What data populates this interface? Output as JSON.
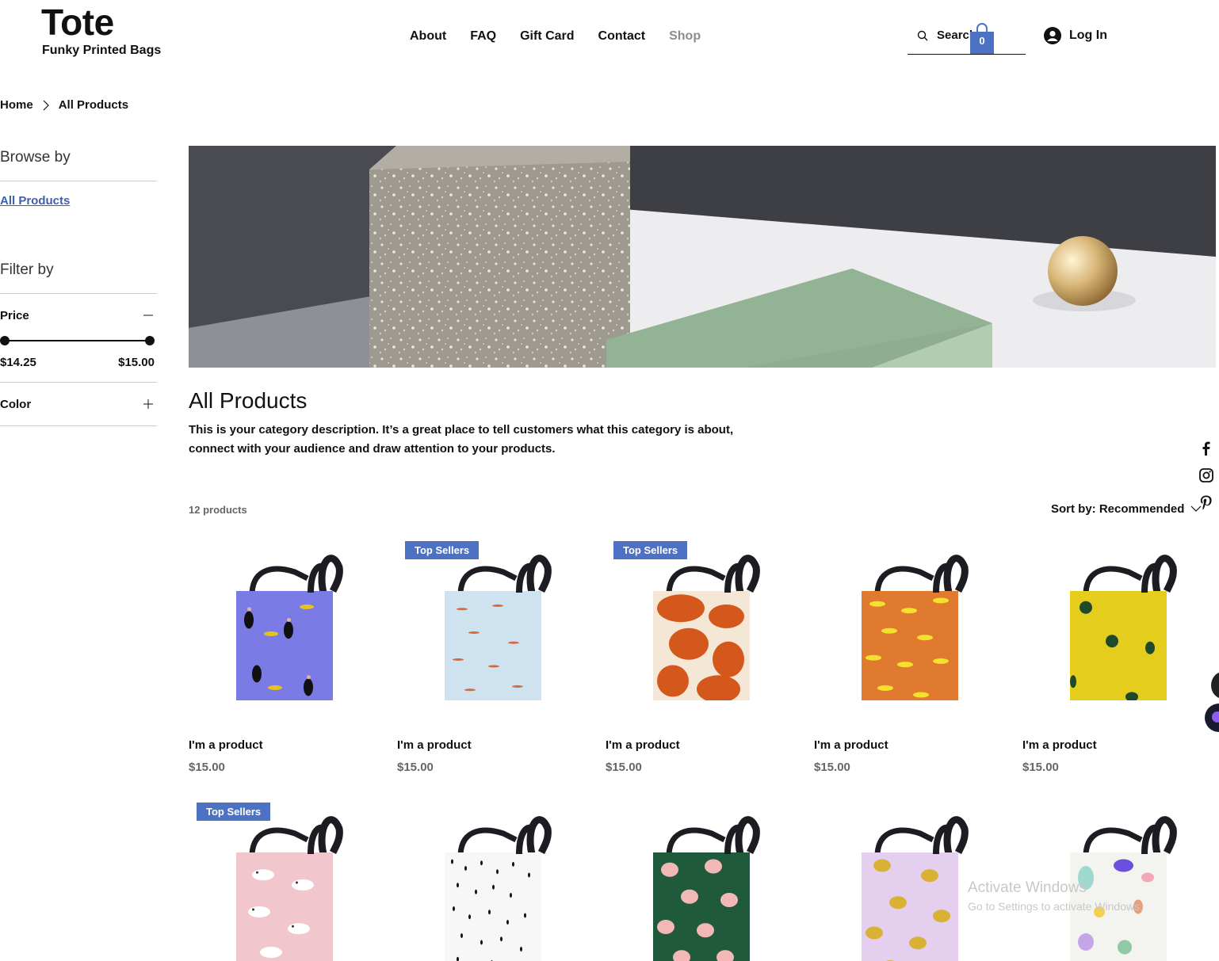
{
  "header": {
    "logo_title": "Tote",
    "logo_subtitle": "Funky Printed Bags",
    "nav": [
      "About",
      "FAQ",
      "Gift Card",
      "Contact",
      "Shop"
    ],
    "search_placeholder": "Search",
    "cart_count": "0",
    "login_label": "Log In"
  },
  "breadcrumb": {
    "home": "Home",
    "current": "All Products"
  },
  "sidebar": {
    "browse_title": "Browse by",
    "browse_link": "All Products",
    "filter_title": "Filter by",
    "price_label": "Price",
    "price_min": "$14.25",
    "price_max": "$15.00",
    "color_label": "Color"
  },
  "category": {
    "title": "All Products",
    "description": "This is your category description. It’s a great place to tell customers what this category is about, connect with your audience and draw attention to your products.",
    "count": "12 products",
    "sort_label": "Sort by: Recommended"
  },
  "products": [
    {
      "name": "I'm a product",
      "price": "$15.00",
      "badge": "",
      "pattern": "purple-women"
    },
    {
      "name": "I'm a product",
      "price": "$15.00",
      "badge": "Top Sellers",
      "pattern": "blue-swimmers"
    },
    {
      "name": "I'm a product",
      "price": "$15.00",
      "badge": "Top Sellers",
      "pattern": "orange-abstract"
    },
    {
      "name": "I'm a product",
      "price": "$15.00",
      "badge": "",
      "pattern": "orange-bananas"
    },
    {
      "name": "I'm a product",
      "price": "$15.00",
      "badge": "",
      "pattern": "yellow-leaves"
    },
    {
      "name": "",
      "price": "",
      "badge": "Top Sellers",
      "pattern": "pink-leopards"
    },
    {
      "name": "",
      "price": "",
      "badge": "",
      "pattern": "white-dots"
    },
    {
      "name": "",
      "price": "",
      "badge": "",
      "pattern": "green-hands"
    },
    {
      "name": "",
      "price": "",
      "badge": "",
      "pattern": "lilac-lemons"
    },
    {
      "name": "",
      "price": "",
      "badge": "",
      "pattern": "white-doodles"
    }
  ],
  "watermark": {
    "title": "Activate Windows",
    "subtitle": "Go to Settings to activate Windows."
  },
  "colors": {
    "accent": "#3d5fad",
    "badge": "#4e72c3"
  }
}
